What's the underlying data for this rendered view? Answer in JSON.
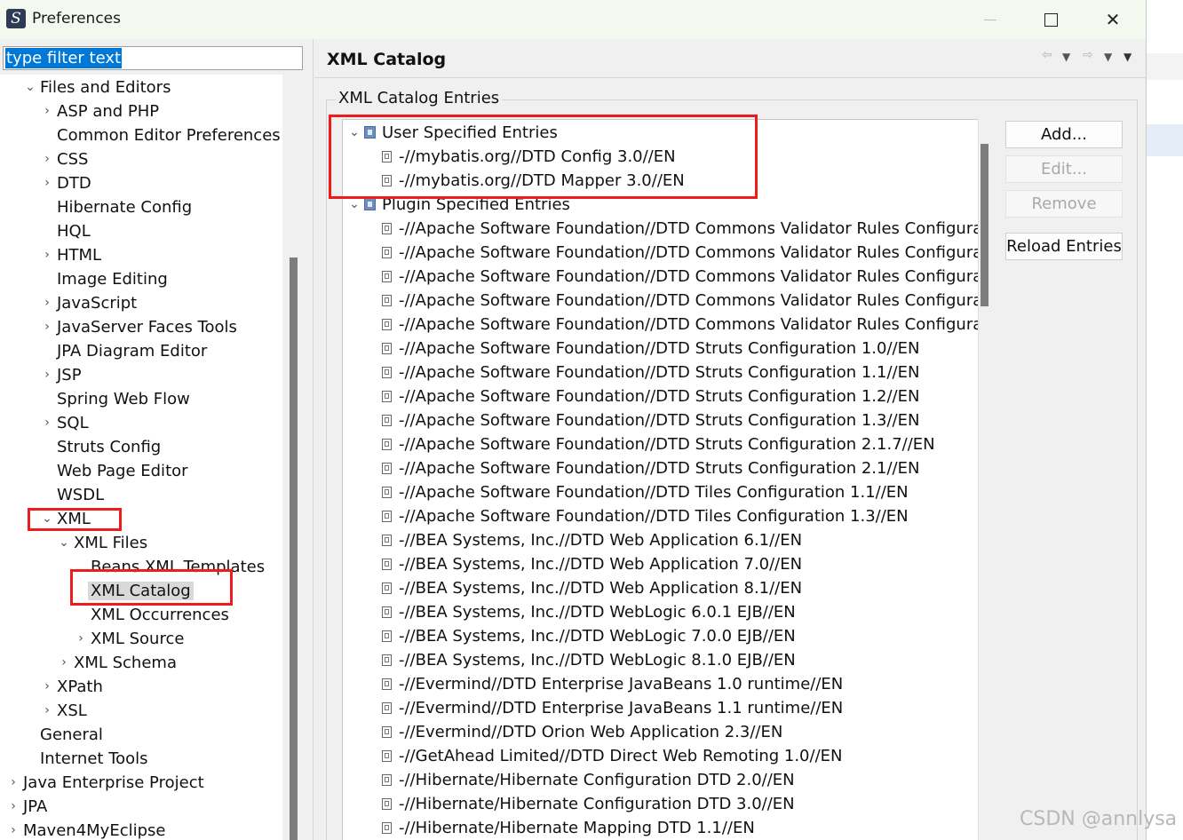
{
  "window": {
    "title": "Preferences"
  },
  "filter": {
    "value": "type filter text"
  },
  "nav": [
    {
      "label": "Files and Editors",
      "level": 1,
      "twisty": "open"
    },
    {
      "label": "ASP and PHP",
      "level": 2,
      "twisty": "closed"
    },
    {
      "label": "Common Editor Preferences",
      "level": 2,
      "twisty": "none"
    },
    {
      "label": "CSS",
      "level": 2,
      "twisty": "closed"
    },
    {
      "label": "DTD",
      "level": 2,
      "twisty": "closed"
    },
    {
      "label": "Hibernate Config",
      "level": 2,
      "twisty": "none"
    },
    {
      "label": "HQL",
      "level": 2,
      "twisty": "none"
    },
    {
      "label": "HTML",
      "level": 2,
      "twisty": "closed"
    },
    {
      "label": "Image Editing",
      "level": 2,
      "twisty": "none"
    },
    {
      "label": "JavaScript",
      "level": 2,
      "twisty": "closed"
    },
    {
      "label": "JavaServer Faces Tools",
      "level": 2,
      "twisty": "closed"
    },
    {
      "label": "JPA Diagram Editor",
      "level": 2,
      "twisty": "none"
    },
    {
      "label": "JSP",
      "level": 2,
      "twisty": "closed"
    },
    {
      "label": "Spring Web Flow",
      "level": 2,
      "twisty": "none"
    },
    {
      "label": "SQL",
      "level": 2,
      "twisty": "closed"
    },
    {
      "label": "Struts Config",
      "level": 2,
      "twisty": "none"
    },
    {
      "label": "Web Page Editor",
      "level": 2,
      "twisty": "none"
    },
    {
      "label": "WSDL",
      "level": 2,
      "twisty": "none"
    },
    {
      "label": "XML",
      "level": 2,
      "twisty": "open"
    },
    {
      "label": "XML Files",
      "level": 3,
      "twisty": "open"
    },
    {
      "label": "Beans XML Templates",
      "level": 4,
      "twisty": "none"
    },
    {
      "label": "XML Catalog",
      "level": 4,
      "twisty": "none",
      "selected": true
    },
    {
      "label": "XML Occurrences",
      "level": 4,
      "twisty": "none"
    },
    {
      "label": "XML Source",
      "level": 4,
      "twisty": "closed"
    },
    {
      "label": "XML Schema",
      "level": 3,
      "twisty": "closed"
    },
    {
      "label": "XPath",
      "level": 2,
      "twisty": "closed"
    },
    {
      "label": "XSL",
      "level": 2,
      "twisty": "closed"
    },
    {
      "label": "General",
      "level": 1,
      "twisty": "none"
    },
    {
      "label": "Internet Tools",
      "level": 1,
      "twisty": "none"
    },
    {
      "label": "Java Enterprise Project",
      "level": 0,
      "twisty": "closed"
    },
    {
      "label": "JPA",
      "level": 0,
      "twisty": "closed"
    },
    {
      "label": "Maven4MyEclipse",
      "level": 0,
      "twisty": "closed"
    }
  ],
  "page": {
    "title": "XML Catalog",
    "group_label": "XML Catalog Entries"
  },
  "catalog": [
    {
      "label": "User Specified Entries",
      "kind": "group"
    },
    {
      "label": "-//mybatis.org//DTD Config 3.0//EN",
      "kind": "entry"
    },
    {
      "label": "-//mybatis.org//DTD Mapper 3.0//EN",
      "kind": "entry"
    },
    {
      "label": "Plugin Specified Entries",
      "kind": "group"
    },
    {
      "label": "-//Apache Software Foundation//DTD Commons Validator Rules Configurat",
      "kind": "entry"
    },
    {
      "label": "-//Apache Software Foundation//DTD Commons Validator Rules Configurat",
      "kind": "entry"
    },
    {
      "label": "-//Apache Software Foundation//DTD Commons Validator Rules Configurat",
      "kind": "entry"
    },
    {
      "label": "-//Apache Software Foundation//DTD Commons Validator Rules Configurat",
      "kind": "entry"
    },
    {
      "label": "-//Apache Software Foundation//DTD Commons Validator Rules Configurat",
      "kind": "entry"
    },
    {
      "label": "-//Apache Software Foundation//DTD Struts Configuration 1.0//EN",
      "kind": "entry"
    },
    {
      "label": "-//Apache Software Foundation//DTD Struts Configuration 1.1//EN",
      "kind": "entry"
    },
    {
      "label": "-//Apache Software Foundation//DTD Struts Configuration 1.2//EN",
      "kind": "entry"
    },
    {
      "label": "-//Apache Software Foundation//DTD Struts Configuration 1.3//EN",
      "kind": "entry"
    },
    {
      "label": "-//Apache Software Foundation//DTD Struts Configuration 2.1.7//EN",
      "kind": "entry"
    },
    {
      "label": "-//Apache Software Foundation//DTD Struts Configuration 2.1//EN",
      "kind": "entry"
    },
    {
      "label": "-//Apache Software Foundation//DTD Tiles Configuration 1.1//EN",
      "kind": "entry"
    },
    {
      "label": "-//Apache Software Foundation//DTD Tiles Configuration 1.3//EN",
      "kind": "entry"
    },
    {
      "label": "-//BEA Systems, Inc.//DTD Web Application 6.1//EN",
      "kind": "entry"
    },
    {
      "label": "-//BEA Systems, Inc.//DTD Web Application 7.0//EN",
      "kind": "entry"
    },
    {
      "label": "-//BEA Systems, Inc.//DTD Web Application 8.1//EN",
      "kind": "entry"
    },
    {
      "label": "-//BEA Systems, Inc.//DTD WebLogic 6.0.1 EJB//EN",
      "kind": "entry"
    },
    {
      "label": "-//BEA Systems, Inc.//DTD WebLogic 7.0.0 EJB//EN",
      "kind": "entry"
    },
    {
      "label": "-//BEA Systems, Inc.//DTD WebLogic 8.1.0 EJB//EN",
      "kind": "entry"
    },
    {
      "label": "-//Evermind//DTD Enterprise JavaBeans 1.0 runtime//EN",
      "kind": "entry"
    },
    {
      "label": "-//Evermind//DTD Enterprise JavaBeans 1.1 runtime//EN",
      "kind": "entry"
    },
    {
      "label": "-//Evermind//DTD Orion Web Application 2.3//EN",
      "kind": "entry"
    },
    {
      "label": "-//GetAhead Limited//DTD Direct Web Remoting 1.0//EN",
      "kind": "entry"
    },
    {
      "label": "-//Hibernate/Hibernate Configuration DTD 2.0//EN",
      "kind": "entry"
    },
    {
      "label": "-//Hibernate/Hibernate Configuration DTD 3.0//EN",
      "kind": "entry"
    },
    {
      "label": "-//Hibernate/Hibernate Mapping DTD 1.1//EN",
      "kind": "entry"
    }
  ],
  "buttons": {
    "add": "Add...",
    "edit": "Edit...",
    "remove": "Remove",
    "reload": "Reload Entries"
  },
  "watermark": "CSDN @annlysa",
  "colors": {
    "highlight": "#ee1c1c",
    "selection": "#0078d7"
  }
}
